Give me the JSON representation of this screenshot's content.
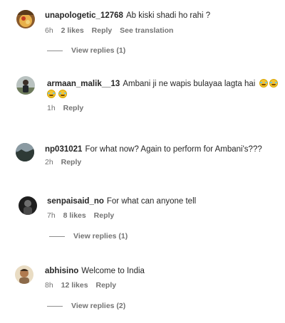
{
  "comments": [
    {
      "username": "unapologetic_12768",
      "text": "Ab kiski shadi ho rahi ?",
      "time": "6h",
      "likes": "2 likes",
      "reply": "Reply",
      "translation": "See translation",
      "view_replies": "View replies (1)",
      "avatar_icon": "avatar-food-photo"
    },
    {
      "username": "armaan_malik__13",
      "text": "Ambani ji ne wapis bulayaa lagta hai",
      "time": "1h",
      "reply": "Reply",
      "avatar_icon": "avatar-person-photo"
    },
    {
      "username": "np031021",
      "text": "For what now? Again to perform for Ambani's???",
      "time": "2h",
      "reply": "Reply",
      "avatar_icon": "avatar-landscape-photo"
    },
    {
      "username": "senpaisaid_no",
      "text": "For what can anyone tell",
      "time": "7h",
      "likes": "8 likes",
      "reply": "Reply",
      "view_replies": "View replies (1)",
      "avatar_icon": "avatar-dark-photo"
    },
    {
      "username": "abhisino",
      "text": "Welcome to India",
      "time": "8h",
      "likes": "12 likes",
      "reply": "Reply",
      "view_replies": "View replies (2)",
      "avatar_icon": "avatar-face-photo"
    }
  ],
  "colors": {
    "text": "#262626",
    "muted": "#737373"
  }
}
